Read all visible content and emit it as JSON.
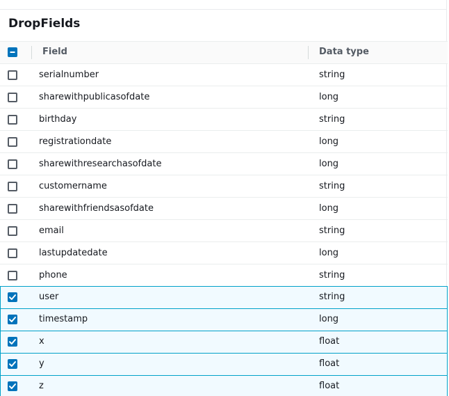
{
  "panel": {
    "title": "DropFields"
  },
  "table": {
    "columns": {
      "field": "Field",
      "data_type": "Data type"
    },
    "select_all_state": "indeterminate",
    "rows": [
      {
        "field": "serialnumber",
        "type": "string",
        "checked": false
      },
      {
        "field": "sharewithpublicasofdate",
        "type": "long",
        "checked": false
      },
      {
        "field": "birthday",
        "type": "string",
        "checked": false
      },
      {
        "field": "registrationdate",
        "type": "long",
        "checked": false
      },
      {
        "field": "sharewithresearchasofdate",
        "type": "long",
        "checked": false
      },
      {
        "field": "customername",
        "type": "string",
        "checked": false
      },
      {
        "field": "sharewithfriendsasofdate",
        "type": "long",
        "checked": false
      },
      {
        "field": "email",
        "type": "string",
        "checked": false
      },
      {
        "field": "lastupdatedate",
        "type": "long",
        "checked": false
      },
      {
        "field": "phone",
        "type": "string",
        "checked": false
      },
      {
        "field": "user",
        "type": "string",
        "checked": true
      },
      {
        "field": "timestamp",
        "type": "long",
        "checked": true
      },
      {
        "field": "x",
        "type": "float",
        "checked": true
      },
      {
        "field": "y",
        "type": "float",
        "checked": true
      },
      {
        "field": "z",
        "type": "float",
        "checked": true
      }
    ]
  },
  "colors": {
    "accent": "#0073bb",
    "selected_row_bg": "#f1faff",
    "selected_row_border": "#00a1c9"
  }
}
